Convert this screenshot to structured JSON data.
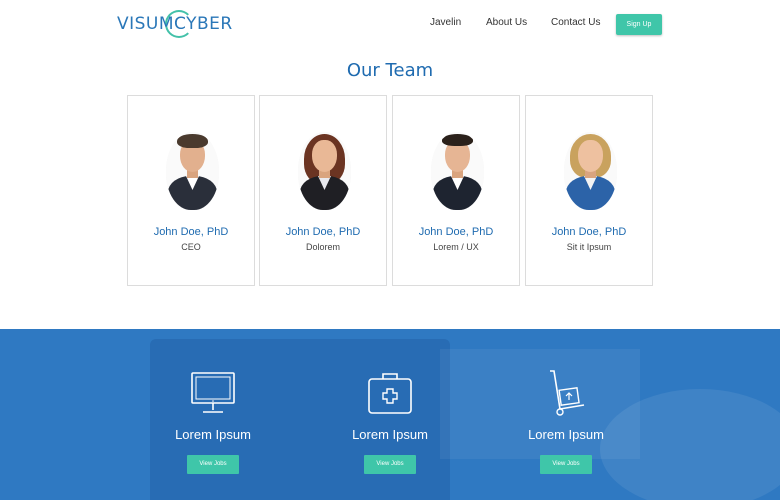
{
  "header": {
    "logo_text": "VISUMCYBER",
    "nav": [
      "Javelin",
      "About Us",
      "Contact Us"
    ],
    "signup_label": "Sign Up"
  },
  "team": {
    "title": "Our Team",
    "members": [
      {
        "name": "John Doe, PhD",
        "role": "CEO"
      },
      {
        "name": "John Doe, PhD",
        "role": "Dolorem"
      },
      {
        "name": "John Doe, PhD",
        "role": "Lorem / UX"
      },
      {
        "name": "John Doe, PhD",
        "role": "Sit it Ipsum"
      }
    ]
  },
  "features": [
    {
      "title": "Lorem Ipsum",
      "button": "View Jobs",
      "icon": "computer-monitor-icon"
    },
    {
      "title": "Lorem Ipsum",
      "button": "View Jobs",
      "icon": "medical-kit-icon"
    },
    {
      "title": "Lorem Ipsum",
      "button": "View Jobs",
      "icon": "hand-truck-icon"
    }
  ],
  "colors": {
    "brand_blue": "#1f6bb0",
    "accent_teal": "#3fc6a9",
    "section_blue": "#2f79c2"
  }
}
